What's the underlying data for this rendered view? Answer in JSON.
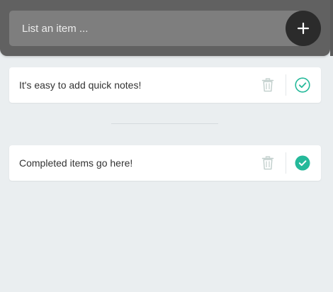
{
  "input": {
    "placeholder": "List an item ..."
  },
  "icons": {
    "add": "plus-icon",
    "delete": "trash-icon",
    "complete": "check-circle-icon"
  },
  "colors": {
    "header": "#616161",
    "input_bg": "#7e7e7e",
    "add_button": "#2b2b2b",
    "accent": "#25b99a",
    "trash": "#c0cecb",
    "background": "#eaeef0"
  },
  "todo": {
    "items": [
      {
        "text": "It's easy to add quick notes!"
      }
    ]
  },
  "completed": {
    "items": [
      {
        "text": "Completed items go here!"
      }
    ]
  }
}
